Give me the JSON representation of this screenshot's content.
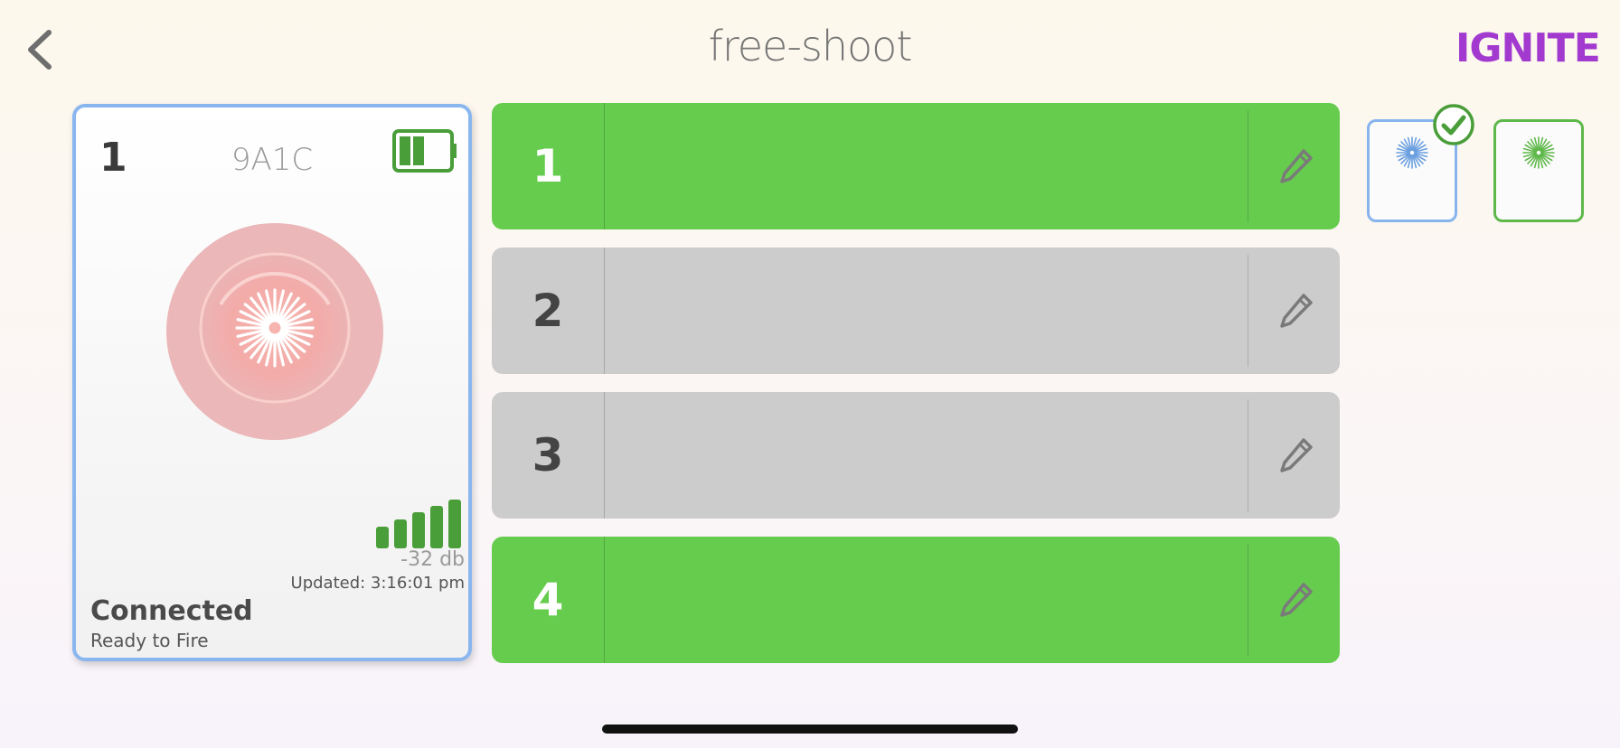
{
  "header": {
    "title": "free-shoot",
    "logo_text": "IGNITE",
    "back_icon": "chevron-left-icon"
  },
  "device": {
    "number": "1",
    "id": "9A1C",
    "battery_icon": "battery-icon",
    "battery_level": 0.6,
    "signal_bars": 5,
    "signal_db": "-32 db",
    "updated": "Updated: 3:16:01 pm",
    "status": "Connected",
    "substatus": "Ready to Fire"
  },
  "cues": [
    {
      "number": "1",
      "active": true
    },
    {
      "number": "2",
      "active": false
    },
    {
      "number": "3",
      "active": false
    },
    {
      "number": "4",
      "active": true
    }
  ],
  "colors": {
    "active": "#66cc4e",
    "inactive": "#cccccc",
    "card_border": "#8ab6ef",
    "logo": "#a23ad0"
  }
}
